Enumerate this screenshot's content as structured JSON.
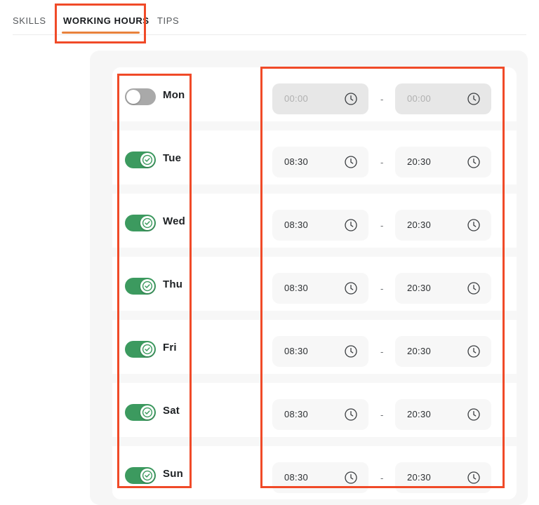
{
  "tabs": [
    {
      "label": "SKILLS",
      "active": false
    },
    {
      "label": "WORKING HOURS",
      "active": true
    },
    {
      "label": "TIPS",
      "active": false
    }
  ],
  "colors": {
    "accent_underline": "#e8823c",
    "annotation_box": "#f04a28",
    "toggle_on": "#3c9a5f",
    "toggle_off": "#a9a9a9",
    "field_background": "#f7f7f7",
    "field_background_disabled": "#e7e7e7"
  },
  "separator": "-",
  "schedule": {
    "rows": [
      {
        "day": "Mon",
        "enabled": false,
        "start": "00:00",
        "end": "00:00",
        "start_placeholder": "00:00",
        "end_placeholder": "00:00"
      },
      {
        "day": "Tue",
        "enabled": true,
        "start": "08:30",
        "end": "20:30",
        "start_placeholder": "00:00",
        "end_placeholder": "00:00"
      },
      {
        "day": "Wed",
        "enabled": true,
        "start": "08:30",
        "end": "20:30",
        "start_placeholder": "00:00",
        "end_placeholder": "00:00"
      },
      {
        "day": "Thu",
        "enabled": true,
        "start": "08:30",
        "end": "20:30",
        "start_placeholder": "00:00",
        "end_placeholder": "00:00"
      },
      {
        "day": "Fri",
        "enabled": true,
        "start": "08:30",
        "end": "20:30",
        "start_placeholder": "00:00",
        "end_placeholder": "00:00"
      },
      {
        "day": "Sat",
        "enabled": true,
        "start": "08:30",
        "end": "20:30",
        "start_placeholder": "00:00",
        "end_placeholder": "00:00"
      },
      {
        "day": "Sun",
        "enabled": true,
        "start": "08:30",
        "end": "20:30",
        "start_placeholder": "00:00",
        "end_placeholder": "00:00"
      }
    ]
  },
  "icons": {
    "clock": "clock-icon",
    "check": "check-circle-icon"
  }
}
